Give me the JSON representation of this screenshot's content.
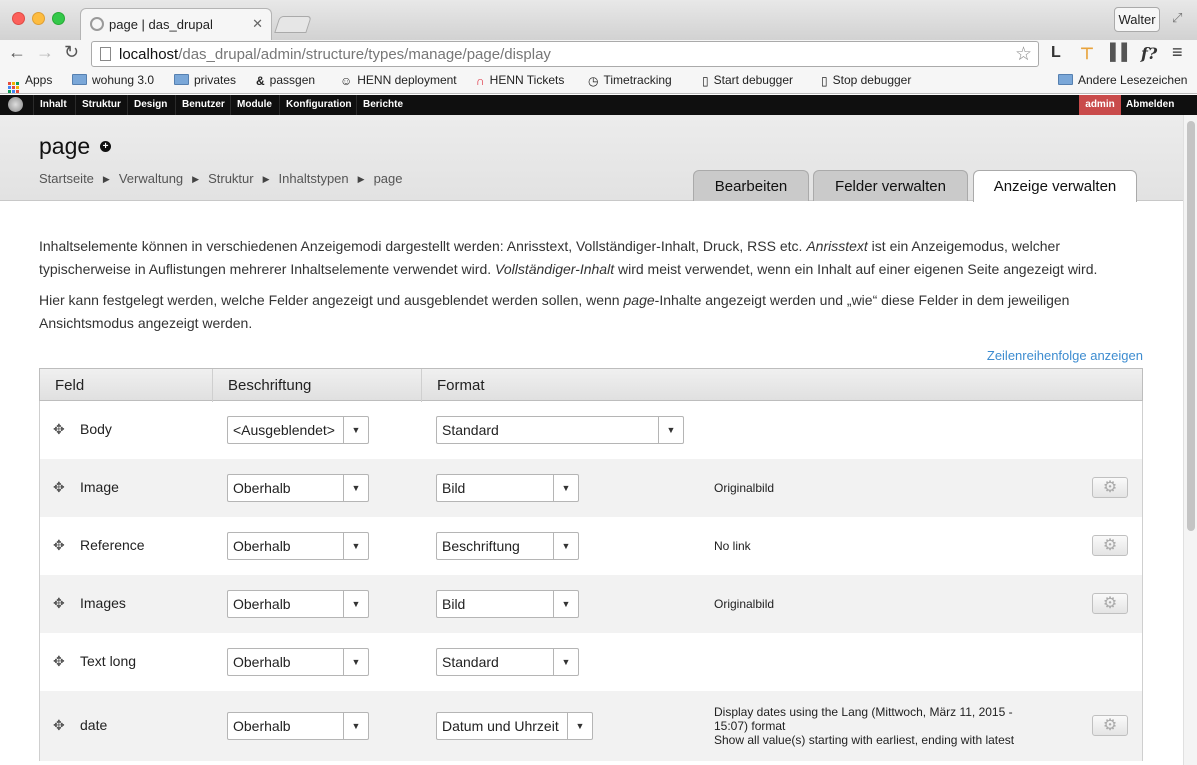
{
  "browser": {
    "tab_title": "page | das_drupal",
    "profile_name": "Walter",
    "url_host": "localhost",
    "url_path": "/das_drupal/admin/structure/types/manage/page/display",
    "extensions": [
      "L",
      "f?"
    ],
    "bookmarks": [
      {
        "label": "Apps",
        "icon": "apps-icon"
      },
      {
        "label": "wohung 3.0",
        "icon": "folder-icon"
      },
      {
        "label": "privates",
        "icon": "folder-icon"
      },
      {
        "label": "passgen",
        "icon": "ampersand-icon"
      },
      {
        "label": "HENN deployment",
        "icon": "owl-icon"
      },
      {
        "label": "HENN Tickets",
        "icon": "arc-icon"
      },
      {
        "label": "Timetracking",
        "icon": "clock-icon"
      },
      {
        "label": "Start debugger",
        "icon": "page-icon"
      },
      {
        "label": "Stop debugger",
        "icon": "page-icon"
      },
      {
        "label": "Andere Lesezeichen",
        "icon": "folder-icon"
      }
    ]
  },
  "drupal_toolbar": {
    "items": [
      "Inhalt",
      "Struktur",
      "Design",
      "Benutzer",
      "Module",
      "Konfiguration",
      "Berichte"
    ],
    "user": "admin",
    "logout": "Abmelden"
  },
  "header": {
    "title": "page",
    "breadcrumb": [
      "Startseite",
      "Verwaltung",
      "Struktur",
      "Inhaltstypen",
      "page"
    ],
    "tabs": [
      "Bearbeiten",
      "Felder verwalten",
      "Anzeige verwalten"
    ],
    "active_tab": "Anzeige verwalten"
  },
  "content": {
    "para1_a": "Inhaltselemente können in verschiedenen Anzeigemodi dargestellt werden: Anrisstext, Vollständiger-Inhalt, Druck, RSS etc. ",
    "para1_b": "Anrisstext",
    "para1_c": " ist ein Anzeigemodus, welcher typischerweise in Auflistungen mehrerer Inhaltselemente verwendet wird. ",
    "para1_d": "Vollständiger-Inhalt",
    "para1_e": " wird meist verwendet, wenn ein Inhalt auf einer eigenen Seite angezeigt wird.",
    "para2_a": "Hier kann festgelegt werden, welche Felder angezeigt und ausgeblendet werden sollen, wenn ",
    "para2_b": "page",
    "para2_c": "-Inhalte angezeigt werden und „wie“ diese Felder in dem jeweiligen Ansichtsmodus angezeigt werden.",
    "row_weight_link": "Zeilenreihenfolge anzeigen"
  },
  "table": {
    "headers": [
      "Feld",
      "Beschriftung",
      "Format"
    ],
    "rows": [
      {
        "field": "Body",
        "label": "<Ausgeblendet>",
        "format": "Standard",
        "summary": "",
        "settings": false
      },
      {
        "field": "Image",
        "label": "Oberhalb",
        "format": "Bild",
        "summary": "Originalbild",
        "settings": true
      },
      {
        "field": "Reference",
        "label": "Oberhalb",
        "format": "Beschriftung",
        "summary": "No link",
        "settings": true
      },
      {
        "field": "Images",
        "label": "Oberhalb",
        "format": "Bild",
        "summary": "Originalbild",
        "settings": true
      },
      {
        "field": "Text long",
        "label": "Oberhalb",
        "format": "Standard",
        "summary": "",
        "settings": false
      },
      {
        "field": "date",
        "label": "Oberhalb",
        "format": "Datum und Uhrzeit",
        "summary": "Display dates using the Lang (Mittwoch, März 11, 2015 - 15:07) format\nShow all value(s) starting with earliest, ending with latest",
        "settings": true
      }
    ]
  }
}
